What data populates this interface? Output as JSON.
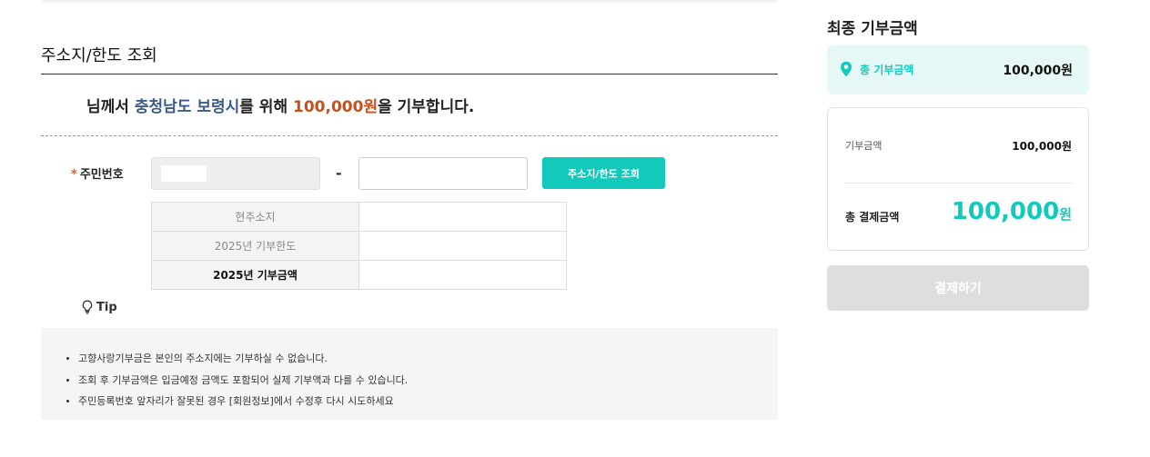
{
  "section": {
    "title": "주소지/한도 조회"
  },
  "headline": {
    "prefix": "님께서 ",
    "region": "충청남도 보령시",
    "middle": "를 위해 ",
    "amount": "100,000원",
    "suffix": "을 기부합니다."
  },
  "ssn": {
    "required_mark": "*",
    "label": "주민번호",
    "dash": "-",
    "back_value": "",
    "lookup_button": "주소지/한도 조회"
  },
  "info_table": {
    "rows": [
      {
        "header": "현주소지",
        "value": ""
      },
      {
        "header": "2025년 기부한도",
        "value": ""
      },
      {
        "header": "2025년 기부금액",
        "value": ""
      }
    ]
  },
  "tip": {
    "label": "Tip",
    "icon": "lightbulb-icon",
    "items": [
      "고향사랑기부금은 본인의 주소지에는 기부하실 수 없습니다.",
      "조회 후 기부금액은 입금예정 금액도 포함되어 실제 기부액과 다를 수 있습니다.",
      "주민등록번호 앞자리가 잘못된 경우 [회원정보]에서 수정후 다시 시도하세요"
    ]
  },
  "sidebar": {
    "title": "최종 기부금액",
    "total_label": "총 기부금액",
    "total_value": "100,000원",
    "pin_icon": "location-pin-icon",
    "donation_label": "기부금액",
    "donation_value": "100,000원",
    "payment_label": "총 결제금액",
    "payment_number": "100,000",
    "payment_unit": "원",
    "pay_button": "결제하기"
  },
  "colors": {
    "accent": "#12c9bb",
    "amount": "#c8501e",
    "region": "#3b5a8f",
    "disabled": "#dedede"
  }
}
